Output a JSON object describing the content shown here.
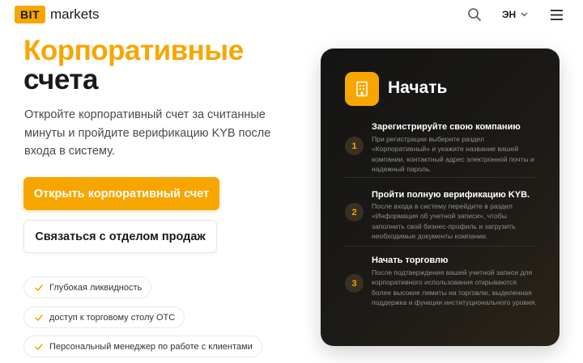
{
  "header": {
    "logo_badge": "BIT",
    "logo_text": "markets",
    "search_icon": "search-icon",
    "language": "ЭН",
    "menu_icon": "hamburger-menu-icon"
  },
  "hero": {
    "title_line1": "Корпоративные",
    "title_line2": "счета",
    "description": "Откройте корпоративный счет за считанные минуты и пройдите верификацию KYB после входа в систему.",
    "primary_button": "Открыть корпоративный счет",
    "secondary_button": "Связаться с отделом продаж"
  },
  "features": [
    {
      "label": "Глубокая ликвидность"
    },
    {
      "label": "доступ к торговому столу OTC"
    },
    {
      "label": "Персональный менеджер по работе с клиентами"
    }
  ],
  "card": {
    "title": "Начать",
    "icon": "building-icon",
    "steps": [
      {
        "number": "1",
        "title": "Зарегистрируйте свою компанию",
        "desc": "При регистрации выберите раздел «Корпоративный» и укажите название вашей компании, контактный адрес электронной почты и надежный пароль."
      },
      {
        "number": "2",
        "title": "Пройти полную верификацию KYB.",
        "desc": "После входа в систему перейдите в раздел «Информация об учетной записи», чтобы заполнить свой бизнес-профиль и загрузить необходимые документы компании."
      },
      {
        "number": "3",
        "title": "Начать торговлю",
        "desc": "После подтверждения вашей учетной записи для корпоративного использования открываются более высокие лимиты на торговлю, выделенная поддержка и функции институционального уровня."
      }
    ]
  },
  "colors": {
    "accent": "#f7a600",
    "card_bg": "#141414",
    "text_dark": "#1a1a1a"
  }
}
